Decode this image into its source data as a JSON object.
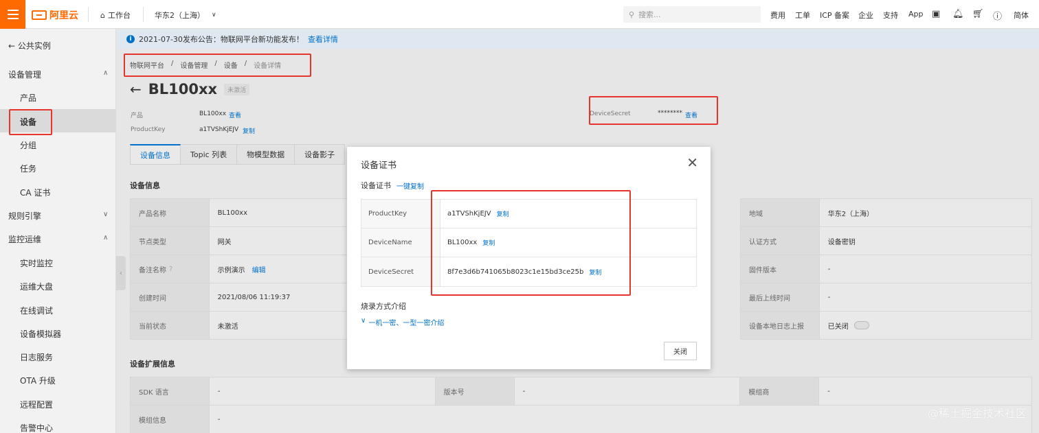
{
  "topbar": {
    "logo_text": "阿里云",
    "workbench": "工作台",
    "region": "华东2（上海）",
    "search_placeholder": "搜索...",
    "links": [
      "费用",
      "工单",
      "ICP 备案",
      "企业",
      "支持",
      "App"
    ],
    "lang": "简体",
    "icons": [
      "terminal-icon",
      "bell-icon",
      "cart-icon",
      "help-icon"
    ]
  },
  "sidebar": {
    "back_label": "公共实例",
    "groups": [
      {
        "label": "设备管理",
        "expanded": true,
        "items": [
          "产品",
          "设备",
          "分组",
          "任务",
          "CA 证书"
        ]
      },
      {
        "label": "规则引擎",
        "expanded": false,
        "items": []
      },
      {
        "label": "监控运维",
        "expanded": true,
        "items": [
          "实时监控",
          "运维大盘",
          "在线调试",
          "设备模拟器",
          "日志服务",
          "OTA 升级",
          "远程配置",
          "告警中心"
        ]
      }
    ],
    "active_item": "设备"
  },
  "notice": {
    "text": "2021-07-30发布公告：物联网平台新功能发布！",
    "link": "查看详情"
  },
  "breadcrumb": [
    "物联网平台",
    "设备管理",
    "设备",
    "设备详情"
  ],
  "breadcrumb_sep": "/",
  "device": {
    "name": "BL100xx",
    "status_badge": "未激活",
    "product_label": "产品",
    "product_value": "BL100xx",
    "product_link": "查看",
    "productkey_label": "ProductKey",
    "productkey_value": "a1TVShKjEJV",
    "productkey_copy": "复制",
    "secret_label": "DeviceSecret",
    "secret_value": "********",
    "secret_link": "查看"
  },
  "tabs": [
    "设备信息",
    "Topic 列表",
    "物模型数据",
    "设备影子"
  ],
  "device_info": {
    "title": "设备信息",
    "left": [
      {
        "label": "产品名称",
        "value": "BL100xx"
      },
      {
        "label": "节点类型",
        "value": "网关"
      },
      {
        "label": "备注名称",
        "value": "示例演示",
        "link": "编辑"
      },
      {
        "label": "创建时间",
        "value": "2021/08/06 11:19:37"
      },
      {
        "label": "当前状态",
        "value": "未激活"
      }
    ],
    "right": [
      {
        "label": "地域",
        "value": "华东2（上海）"
      },
      {
        "label": "认证方式",
        "value": "设备密钥"
      },
      {
        "label": "固件版本",
        "value": "-"
      },
      {
        "label": "最后上线时间",
        "value": "-"
      },
      {
        "label": "设备本地日志上报",
        "value": "已关闭"
      }
    ]
  },
  "ext_info": {
    "title": "设备扩展信息",
    "rows": [
      {
        "label": "SDK 语言",
        "value": "-",
        "label2": "版本号",
        "value2": "-",
        "label3": "模组商",
        "value3": "-"
      },
      {
        "label": "模组信息",
        "value": "-"
      }
    ]
  },
  "modal": {
    "title": "设备证书",
    "section_label": "设备证书",
    "copy_all": "一键复制",
    "rows": [
      {
        "key": "ProductKey",
        "value": "a1TVShKjEJV",
        "copy": "复制"
      },
      {
        "key": "DeviceName",
        "value": "BL100xx",
        "copy": "复制"
      },
      {
        "key": "DeviceSecret",
        "value": "8f7e3d6b741065b8023c1e15bd3ce25b",
        "copy": "复制"
      }
    ],
    "burn_title": "烧录方式介绍",
    "burn_link": "一机一密、一型一密介绍",
    "close_button": "关闭"
  },
  "watermark": "@稀土掘金技术社区",
  "colors": {
    "accent": "#ff6a00",
    "link": "#0070cc",
    "highlight_box": "#e4352d"
  }
}
